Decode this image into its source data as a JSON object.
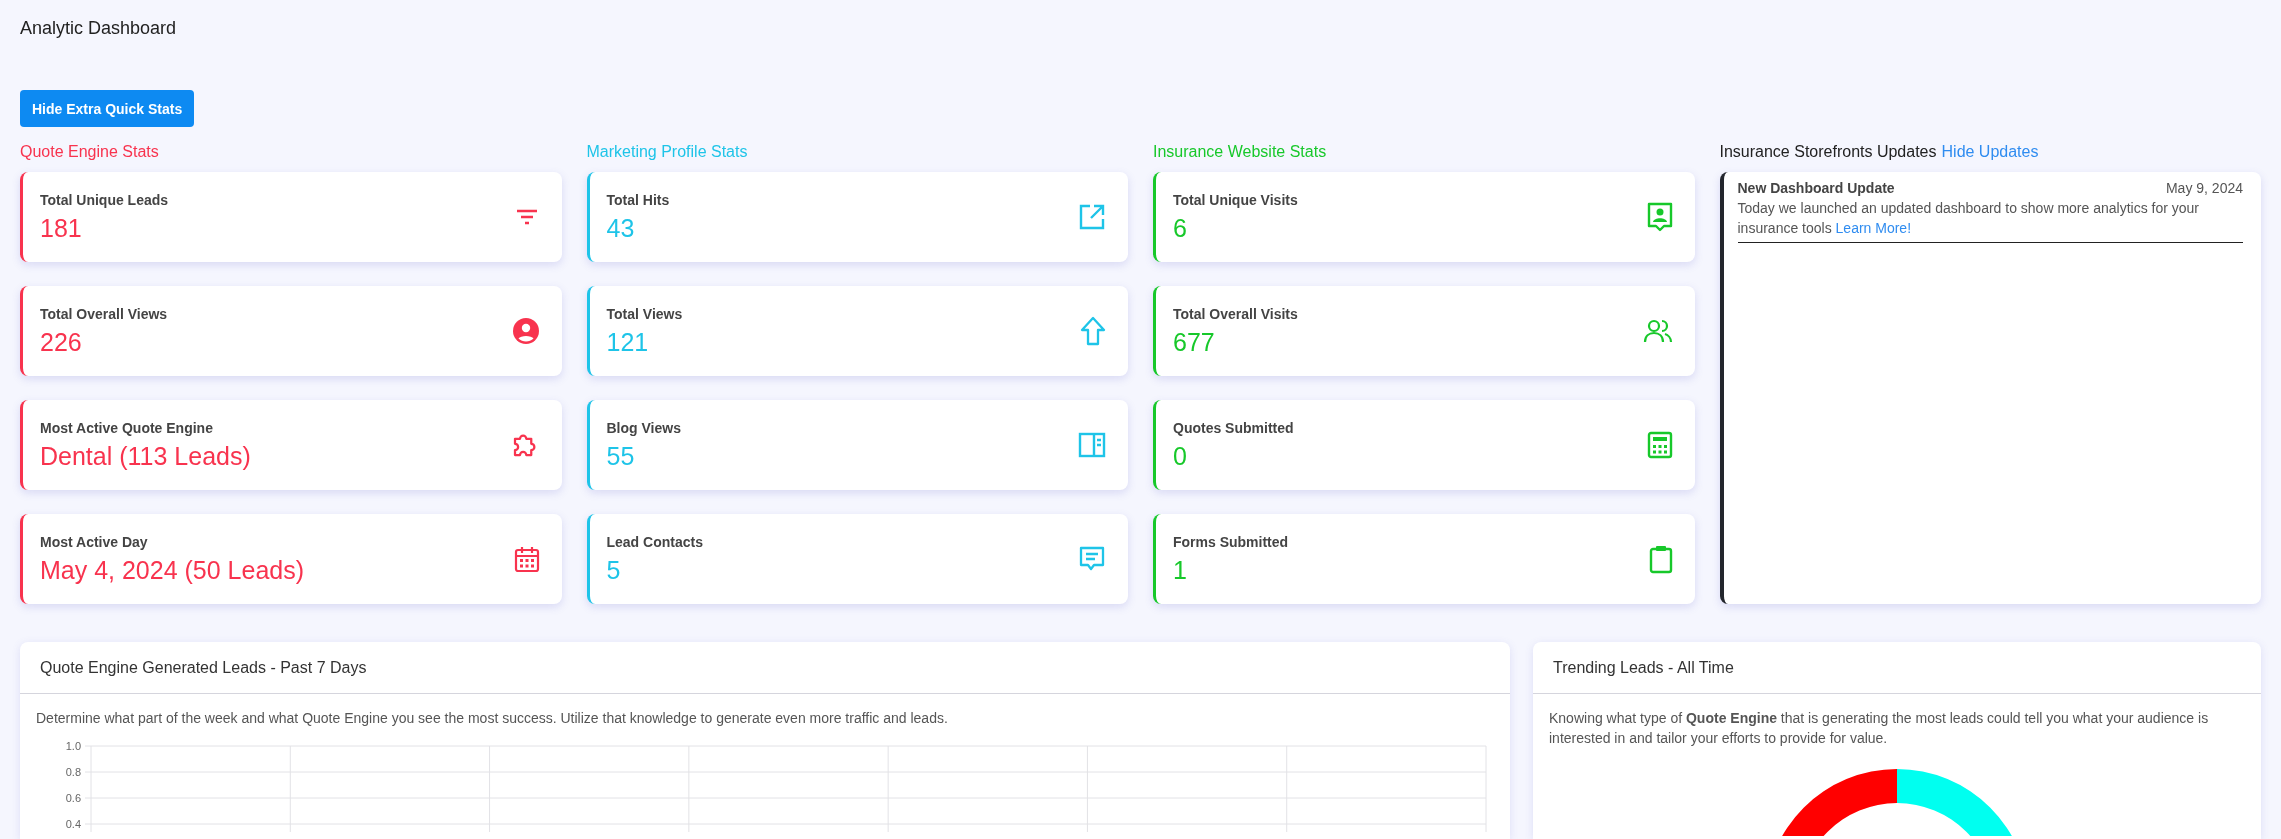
{
  "page": {
    "title": "Analytic Dashboard"
  },
  "toggle_button": {
    "label": "Hide Extra Quick Stats"
  },
  "stat_groups": [
    {
      "title": "Quote Engine Stats",
      "color": "#f8334e",
      "cards": [
        {
          "label": "Total Unique Leads",
          "value": "181"
        },
        {
          "label": "Total Overall Views",
          "value": "226"
        },
        {
          "label": "Most Active Quote Engine",
          "value": "Dental (113 Leads)"
        },
        {
          "label": "Most Active Day",
          "value": "May 4, 2024 (50 Leads)"
        }
      ]
    },
    {
      "title": "Marketing Profile Stats",
      "color": "#1ec4e8",
      "cards": [
        {
          "label": "Total Hits",
          "value": "43"
        },
        {
          "label": "Total Views",
          "value": "121"
        },
        {
          "label": "Blog Views",
          "value": "55"
        },
        {
          "label": "Lead Contacts",
          "value": "5"
        }
      ]
    },
    {
      "title": "Insurance Website Stats",
      "color": "#17c82a",
      "cards": [
        {
          "label": "Total Unique Visits",
          "value": "6"
        },
        {
          "label": "Total Overall Visits",
          "value": "677"
        },
        {
          "label": "Quotes Submitted",
          "value": "0"
        },
        {
          "label": "Forms Submitted",
          "value": "1"
        }
      ]
    }
  ],
  "updates": {
    "title": "Insurance Storefronts Updates",
    "action_link": "Hide Updates",
    "items": [
      {
        "title": "New Dashboard Update",
        "date": "May 9, 2024",
        "text": "Today we launched an updated dashboard to show more analytics for your insurance tools",
        "link": "Learn More!"
      }
    ]
  },
  "panels": [
    {
      "kind": "line",
      "title": "Quote Engine Generated Leads - Past 7 Days",
      "description": "Determine what part of the week and what Quote Engine you see the most success. Utilize that knowledge to generate even more traffic and leads.",
      "y_axis_labels": [
        "1.0",
        "0.8",
        "0.6",
        "0.4"
      ]
    },
    {
      "kind": "donut",
      "title": "Trending Leads - All Time",
      "description": "Knowing what type of **Quote Engine** that is generating the most leads could tell you what your audience is interested in and tailor your efforts to provide for value."
    }
  ]
}
